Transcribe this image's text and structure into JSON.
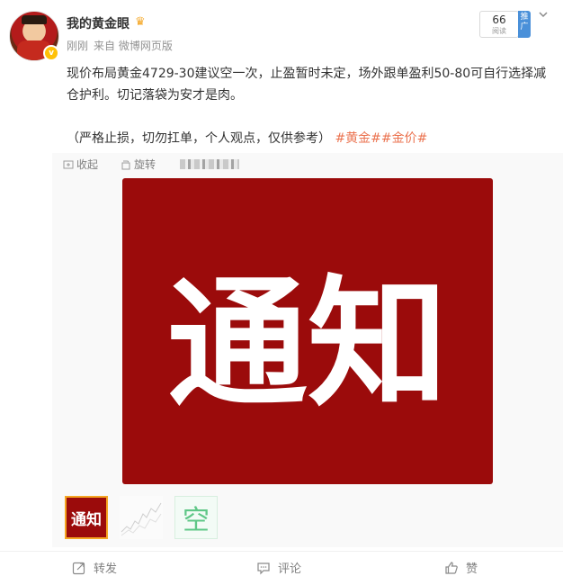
{
  "post": {
    "username": "我的黄金眼",
    "meta": {
      "time": "刚刚",
      "source": "来自 微博网页版"
    },
    "reads": {
      "count": "66",
      "label": "阅读"
    },
    "promo_label": "推广",
    "text_line1": "现价布局黄金4729-30建议空一次，止盈暂时未定，场外跟单盈利50-80可自行选择减仓护利。切记落袋为安才是肉。",
    "text_line2_prefix": "（严格止损，切勿扛单，个人观点，仅供参考）",
    "tags": [
      "#黄金#",
      "#金价#"
    ]
  },
  "media_toolbar": {
    "collect_label": "收起",
    "rotate_label": "旋转"
  },
  "image": {
    "big_text": "通知",
    "thumb1_text": "通知",
    "thumb3_text": "空"
  },
  "actions": {
    "repost_label": "转发",
    "comment_label": "评论",
    "like_label": "赞"
  },
  "icons": [
    "chevron-down-icon",
    "collapse-icon",
    "rotate-icon",
    "repost-icon",
    "comment-icon",
    "like-icon",
    "crown-icon",
    "verified-icon"
  ],
  "colors": {
    "accent_tag": "#eb7350",
    "image_red": "#9b0b0b",
    "promo_blue": "#4a90d9",
    "thumb_border": "#f5a623"
  }
}
